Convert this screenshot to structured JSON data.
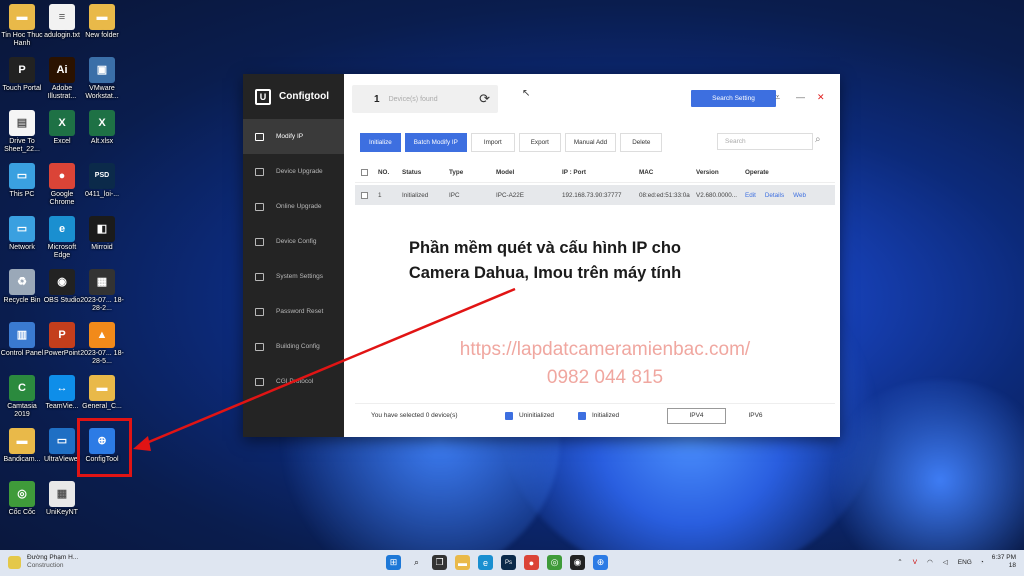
{
  "desktop": {
    "icons": [
      {
        "label": "Tin Hoc Thuc Hanh",
        "color": "#e9b949",
        "glyph": "▬"
      },
      {
        "label": "adulogin.txt",
        "color": "#f2f2f2",
        "glyph": "≡"
      },
      {
        "label": "New folder",
        "color": "#e9b949",
        "glyph": "▬"
      },
      {
        "label": "Touch Portal",
        "color": "#222222",
        "glyph": "P"
      },
      {
        "label": "Adobe Illustrat...",
        "color": "#2b1200",
        "glyph": "Ai"
      },
      {
        "label": "VMware Workstat...",
        "color": "#3b6fa8",
        "glyph": "▣"
      },
      {
        "label": "Drive To Sheet_22...",
        "color": "#f5f5f5",
        "glyph": "▤"
      },
      {
        "label": "Excel",
        "color": "#1e7145",
        "glyph": "X"
      },
      {
        "label": "Alt.xlsx",
        "color": "#1e7145",
        "glyph": "X"
      },
      {
        "label": "This PC",
        "color": "#3aa0e0",
        "glyph": "▭"
      },
      {
        "label": "Google Chrome",
        "color": "#db4437",
        "glyph": "●"
      },
      {
        "label": "0411_loi-...",
        "color": "#0b2a4a",
        "glyph": "PSD"
      },
      {
        "label": "Network",
        "color": "#3aa0e0",
        "glyph": "▭"
      },
      {
        "label": "Microsoft Edge",
        "color": "#1a8fd0",
        "glyph": "e"
      },
      {
        "label": "Mirroid",
        "color": "#1b1b1b",
        "glyph": "◧"
      },
      {
        "label": "Recycle Bin",
        "color": "#9aa8b8",
        "glyph": "♻"
      },
      {
        "label": "OBS Studio",
        "color": "#222222",
        "glyph": "◉"
      },
      {
        "label": "2023-07... 18-28-2...",
        "color": "#333333",
        "glyph": "▦"
      },
      {
        "label": "Control Panel",
        "color": "#3a7ad0",
        "glyph": "▥"
      },
      {
        "label": "PowerPoint",
        "color": "#c43e1c",
        "glyph": "P"
      },
      {
        "label": "2023-07... 18-28-5...",
        "color": "#f28a1a",
        "glyph": "▲"
      },
      {
        "label": "Camtasia 2019",
        "color": "#2b8a3e",
        "glyph": "C"
      },
      {
        "label": "TeamVie...",
        "color": "#0e8ee9",
        "glyph": "↔"
      },
      {
        "label": "General_C...",
        "color": "#e9b949",
        "glyph": "▬"
      },
      {
        "label": "Bandicam...",
        "color": "#e9b949",
        "glyph": "▬"
      },
      {
        "label": "UltraViewer",
        "color": "#1f6fc4",
        "glyph": "▭"
      },
      {
        "label": "ConfigTool",
        "color": "#2c7be5",
        "glyph": "⊕"
      },
      {
        "label": "Cốc Cốc",
        "color": "#3f9b3a",
        "glyph": "◎"
      },
      {
        "label": "UniKeyNT",
        "color": "#e8e8e8",
        "glyph": "▦"
      }
    ]
  },
  "app": {
    "brand": "Configtool",
    "nav": [
      {
        "label": "Modify IP",
        "active": true
      },
      {
        "label": "Device Upgrade"
      },
      {
        "label": "Online Upgrade"
      },
      {
        "label": "Device Config"
      },
      {
        "label": "System Settings"
      },
      {
        "label": "Password Reset"
      },
      {
        "label": "Building Config"
      },
      {
        "label": "CGI Protocol"
      }
    ],
    "device_count": "1",
    "device_found_text": "Device(s) found",
    "search_setting": "Search Setting",
    "toolbar": {
      "initialize": "Initialize",
      "batch_modify": "Batch Modify IP",
      "import": "Import",
      "export": "Export",
      "manual_add": "Manual Add",
      "delete": "Delete"
    },
    "search_placeholder": "Search",
    "table": {
      "headers": [
        "NO.",
        "Status",
        "Type",
        "Model",
        "IP : Port",
        "MAC",
        "Version",
        "Operate"
      ],
      "rows": [
        {
          "no": "1",
          "status": "Initialized",
          "type": "IPC",
          "model": "IPC-A22E",
          "ip": "192.168.73.90:37777",
          "mac": "08:ed:ed:51:33:0a",
          "version": "V2.680.0000...",
          "ops": [
            "Edit",
            "Details",
            "Web"
          ]
        }
      ]
    },
    "footer": {
      "selected_text": "You have selected 0  device(s)",
      "uninitialized": "Uninitialized",
      "initialized": "Initialized",
      "ipv4": "IPV4",
      "ipv6": "IPV6"
    }
  },
  "overlay": {
    "caption_line1": "Phần mềm quét và cấu hình IP cho",
    "caption_line2": "Camera Dahua, Imou trên máy tính",
    "url": "https://lapdatcameramienbac.com/",
    "phone": "0982 044 815"
  },
  "taskbar": {
    "weather_line1": "Đường Phạm H...",
    "weather_line2": "Construction",
    "lang": "ENG",
    "time": "6:37 PM",
    "date": "18"
  }
}
